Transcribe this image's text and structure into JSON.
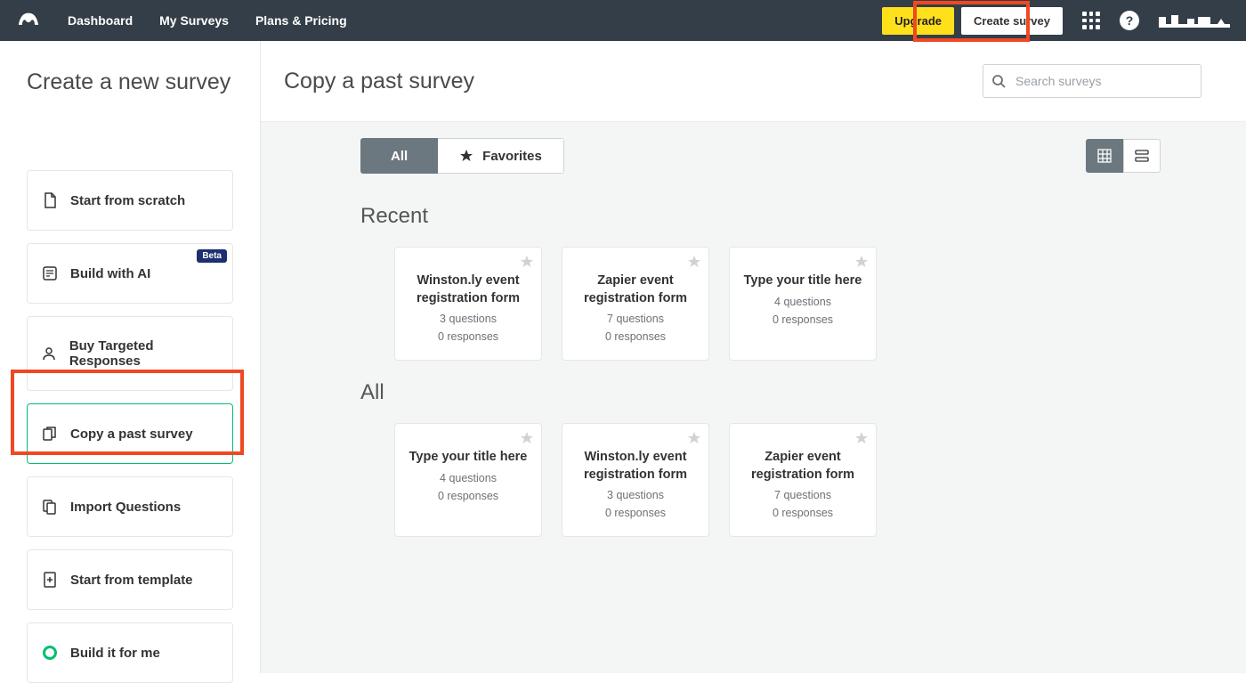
{
  "header": {
    "nav": [
      "Dashboard",
      "My Surveys",
      "Plans & Pricing"
    ],
    "upgrade_label": "Upgrade",
    "create_label": "Create survey"
  },
  "sidebar": {
    "title": "Create a new survey",
    "options": [
      {
        "label": "Start from scratch",
        "icon": "doc-icon",
        "selected": false
      },
      {
        "label": "Build with AI",
        "icon": "ai-icon",
        "badge": "Beta",
        "selected": false
      },
      {
        "label": "Buy Targeted Responses",
        "icon": "user-icon",
        "selected": false
      },
      {
        "label": "Copy a past survey",
        "icon": "copy-icon",
        "selected": true
      },
      {
        "label": "Import Questions",
        "icon": "import-icon",
        "selected": false
      },
      {
        "label": "Start from template",
        "icon": "template-icon",
        "selected": false
      },
      {
        "label": "Build it for me",
        "icon": "ring-icon",
        "selected": false
      }
    ]
  },
  "main": {
    "title": "Copy a past survey",
    "search_placeholder": "Search surveys",
    "filter_all": "All",
    "filter_fav": "Favorites",
    "section_recent": "Recent",
    "section_all": "All",
    "recent_cards": [
      {
        "title": "Winston.ly event registration form",
        "questions": "3 questions",
        "responses": "0 responses"
      },
      {
        "title": "Zapier event registration form",
        "questions": "7 questions",
        "responses": "0 responses"
      },
      {
        "title": "Type your title here",
        "questions": "4 questions",
        "responses": "0 responses"
      }
    ],
    "all_cards": [
      {
        "title": "Type your title here",
        "questions": "4 questions",
        "responses": "0 responses"
      },
      {
        "title": "Winston.ly event registration form",
        "questions": "3 questions",
        "responses": "0 responses"
      },
      {
        "title": "Zapier event registration form",
        "questions": "7 questions",
        "responses": "0 responses"
      }
    ]
  },
  "colors": {
    "accent_green": "#00bf6f",
    "highlight_orange": "#ef4823",
    "upgrade_yellow": "#ffe01b"
  }
}
